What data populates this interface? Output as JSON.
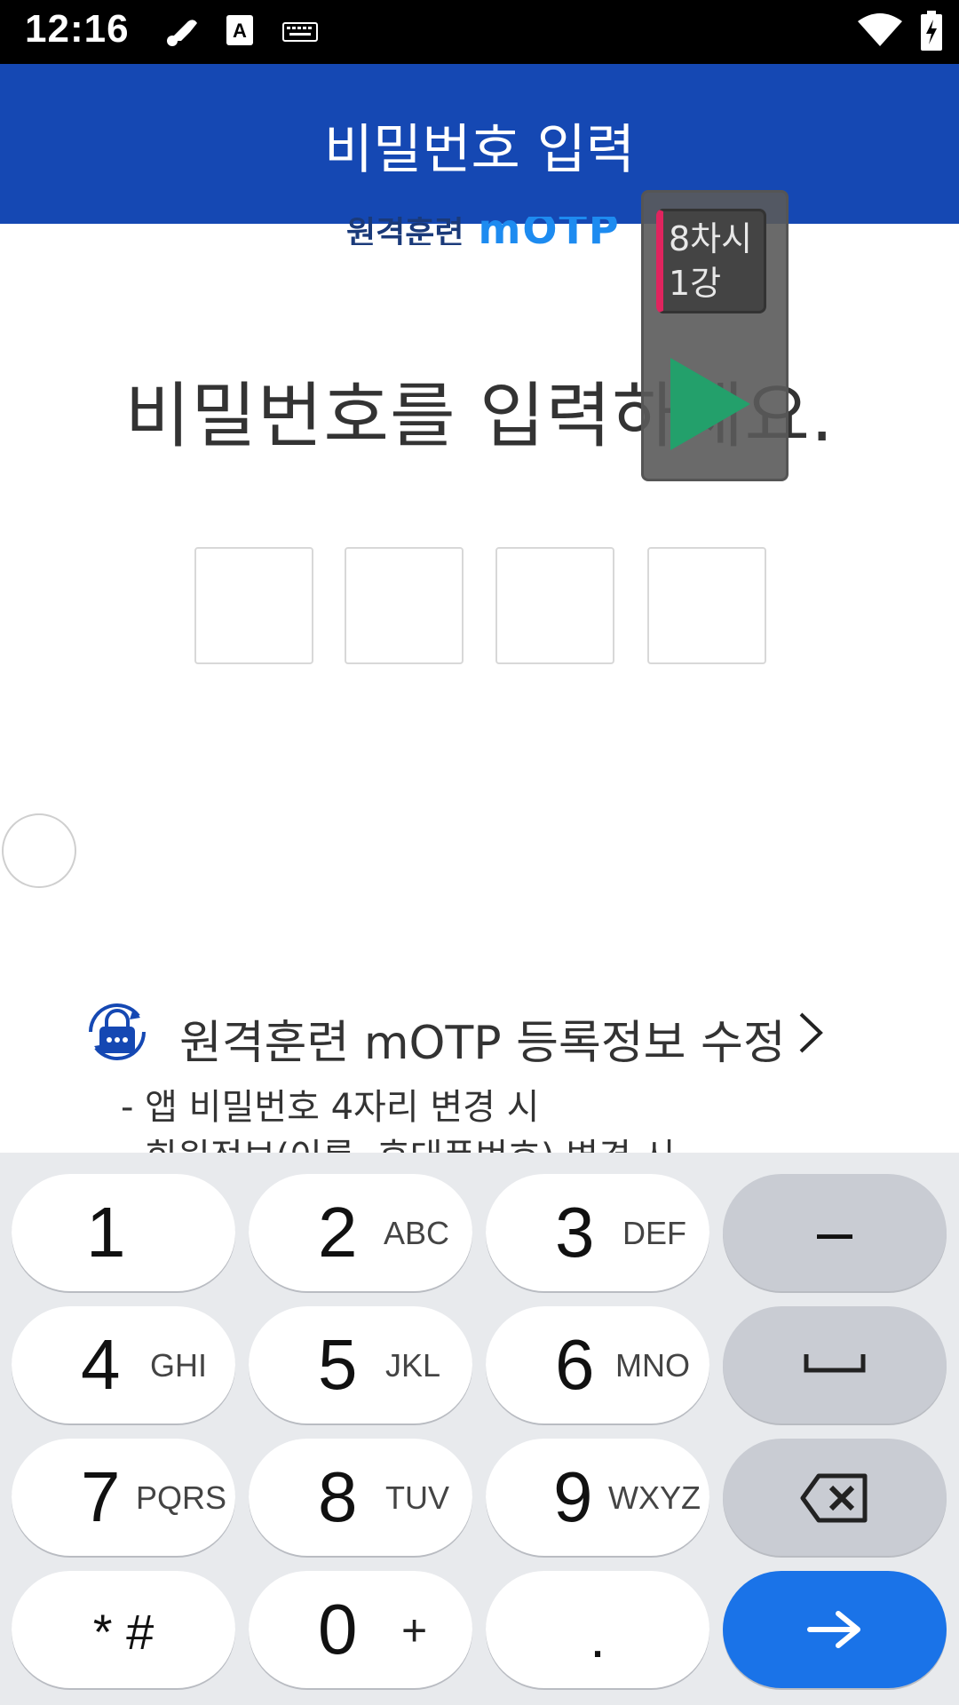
{
  "status_bar": {
    "time": "12:16",
    "icons": [
      "bug-icon",
      "font-a-icon",
      "keyboard-icon",
      "wifi-icon",
      "battery-charging-icon"
    ]
  },
  "app_bar": {
    "title": "비밀번호 입력"
  },
  "logo": {
    "korean": "원격훈련",
    "brand": "mOTP"
  },
  "main": {
    "heading": "비밀번호를 입력하세요.",
    "pin_box_count": 4
  },
  "overlay": {
    "badge_line1": "8차시",
    "badge_line2": "1강"
  },
  "info": {
    "title": "원격훈련 mOTP 등록정보 수정",
    "lines": [
      "- 앱 비밀번호 4자리 변경 시",
      "- 회원정보(이름, 휴대폰번호) 변경 시"
    ]
  },
  "keyboard": {
    "keys": [
      {
        "num": "1",
        "letters": ""
      },
      {
        "num": "2",
        "letters": "ABC"
      },
      {
        "num": "3",
        "letters": "DEF"
      },
      {
        "label": "–"
      },
      {
        "num": "4",
        "letters": "GHI"
      },
      {
        "num": "5",
        "letters": "JKL"
      },
      {
        "num": "6",
        "letters": "MNO"
      },
      {
        "icon": "space-icon"
      },
      {
        "num": "7",
        "letters": "PQRS"
      },
      {
        "num": "8",
        "letters": "TUV"
      },
      {
        "num": "9",
        "letters": "WXYZ"
      },
      {
        "icon": "backspace-icon"
      },
      {
        "label": "* #"
      },
      {
        "num": "0",
        "letters": "+"
      },
      {
        "label": "."
      },
      {
        "icon": "arrow-right-icon"
      }
    ]
  },
  "colors": {
    "app_bar": "#1548b3",
    "accent_blue": "#1a73e8",
    "play_green": "#23a06b",
    "badge_pink": "#e0245e"
  }
}
